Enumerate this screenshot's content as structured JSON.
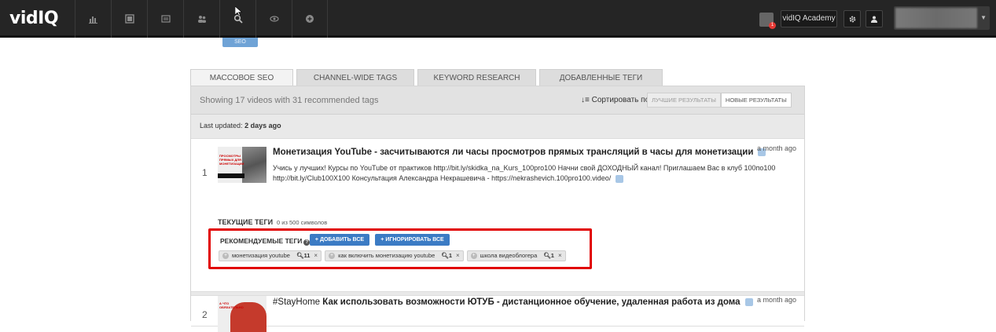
{
  "app": {
    "logo": "vidIQ"
  },
  "topnav": {
    "icons": [
      "stats-icon",
      "film-icon",
      "list-icon",
      "users-icon",
      "search-icon",
      "eye-icon",
      "plus-circle-icon"
    ],
    "academy_label": "vidIQ Academy",
    "notif_badge": "1"
  },
  "seo_pill": "SEO",
  "tabs": [
    "МАССОВОЕ SEO",
    "CHANNEL-WIDE TAGS",
    "KEYWORD RESEARCH",
    "ДОБАВЛЕННЫЕ ТЕГИ"
  ],
  "bar": {
    "showing": "Showing 17 videos with 31 recommended tags",
    "sort_label": "Сортировать по",
    "sort_best": "ЛУЧШИЕ РЕЗУЛЬТАТЫ",
    "sort_new": "НОВЫЕ РЕЗУЛЬТАТЫ"
  },
  "updated": {
    "label": "Last updated:",
    "value": "2 days ago"
  },
  "videos": [
    {
      "num": "1",
      "thumb_text": "ПРОСМОТРЫ ПРЯМЫХ ДЛЯ МОНЕТИЗАЦИИ",
      "title": "Монетизация YouTube - засчитываются ли часы просмотров прямых трансляций в часы для монетизации",
      "ago": "a month ago",
      "desc": "Учись у лучших! Курсы по YouTube от практиков http://bit.ly/skidka_na_Kurs_100pro100 Начни свой ДОХОДНЫЙ канал! Приглашаем Вас в клуб 100по100 http://bit.ly/Club100X100 Консультация Александра Некрашевича - https://nekrashevich.100pro100.video/",
      "current_tags_label": "ТЕКУЩИЕ ТЕГИ",
      "current_tags_count": "0 из 500 символов",
      "recommended_label": "РЕКОМЕНДУЕМЫЕ ТЕГИ",
      "add_all": "+ ДОБАВИТЬ ВСЕ",
      "ignore_all": "+ ИГНОРИРОВАТЬ ВСЕ",
      "tags": [
        {
          "text": "монетизация youtube",
          "count": "11"
        },
        {
          "text": "как включить монетизацию youtube",
          "count": "1"
        },
        {
          "text": "школа видеоблогера",
          "count": "1"
        }
      ]
    },
    {
      "num": "2",
      "thumb_text": "А ЧТО ОБЯЗАТЕЛЬНО",
      "title_tag": "#StayHome",
      "title": "Как использовать возможности ЮТУБ - дистанционное обучение, удаленная работа из дома",
      "ago": "a month ago"
    }
  ]
}
